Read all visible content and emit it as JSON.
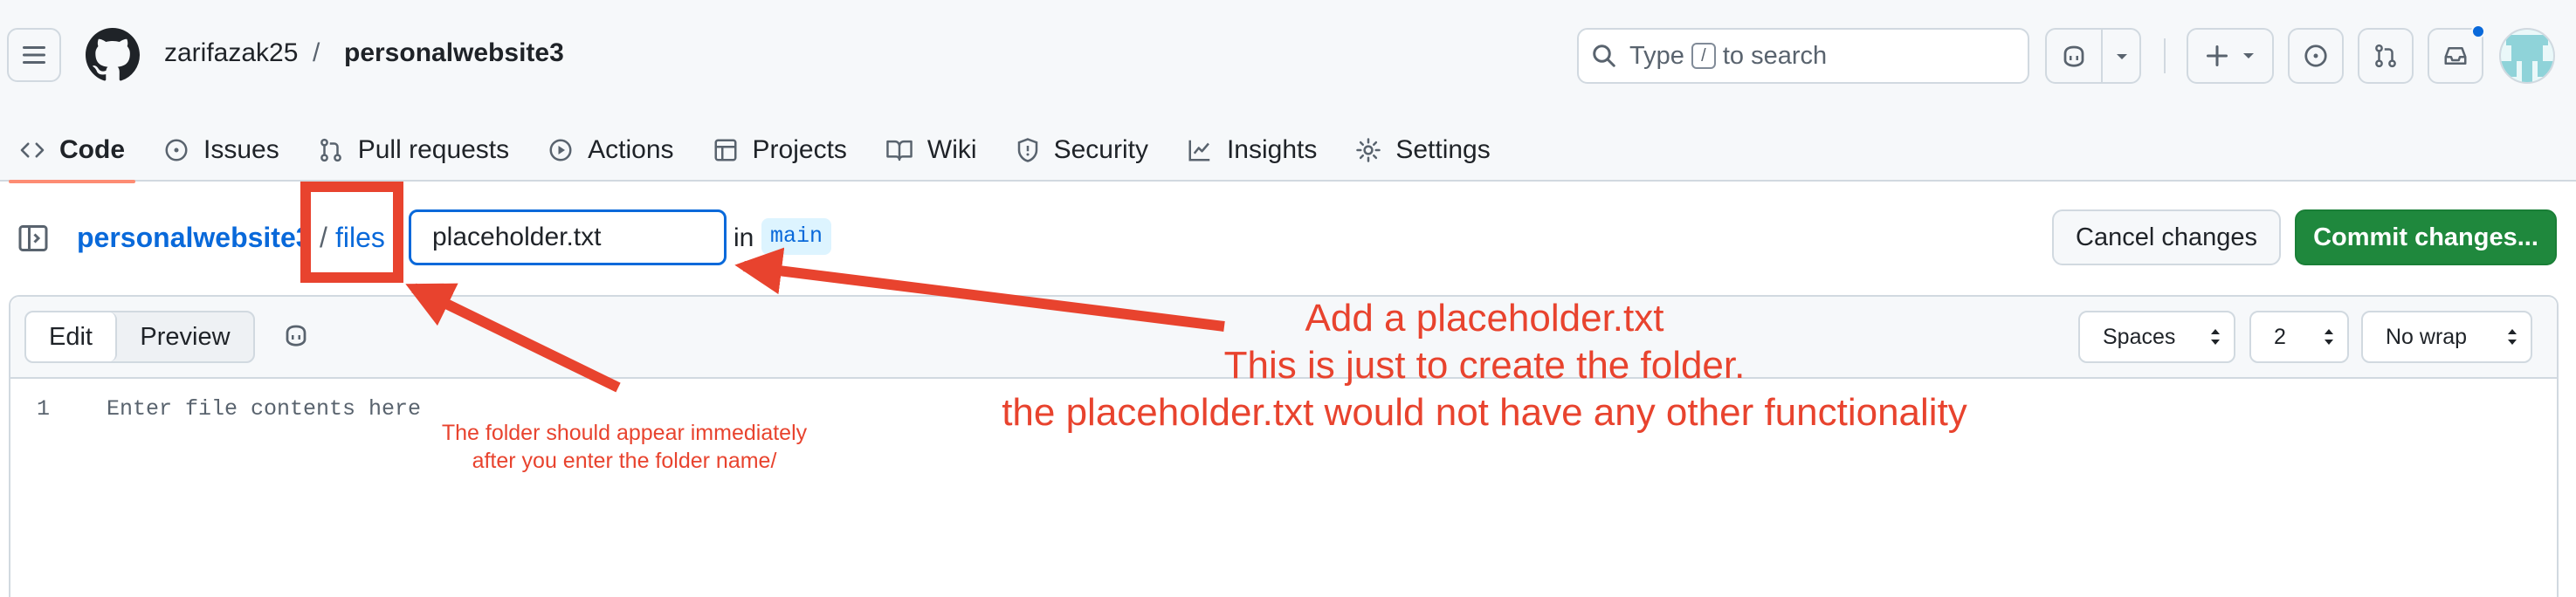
{
  "header": {
    "owner": "zarifazak25",
    "separator": "/",
    "repo": "personalwebsite3",
    "search": {
      "prefix": "Type",
      "key": "/",
      "suffix": "to search"
    }
  },
  "tabs": [
    {
      "label": "Code",
      "icon": "code-icon",
      "active": true
    },
    {
      "label": "Issues",
      "icon": "issue-icon"
    },
    {
      "label": "Pull requests",
      "icon": "pull-request-icon"
    },
    {
      "label": "Actions",
      "icon": "play-icon"
    },
    {
      "label": "Projects",
      "icon": "table-icon"
    },
    {
      "label": "Wiki",
      "icon": "book-icon"
    },
    {
      "label": "Security",
      "icon": "shield-icon"
    },
    {
      "label": "Insights",
      "icon": "graph-icon"
    },
    {
      "label": "Settings",
      "icon": "gear-icon"
    }
  ],
  "path": {
    "repo": "personalwebsite3",
    "sep1": "/",
    "folder": "files",
    "sep2": "/",
    "filename": "placeholder.txt",
    "in": "in",
    "branch": "main"
  },
  "actions": {
    "cancel": "Cancel changes",
    "commit": "Commit changes..."
  },
  "editor": {
    "tab_edit": "Edit",
    "tab_preview": "Preview",
    "indent_mode": "Spaces",
    "indent_size": "2",
    "wrap_mode": "No wrap",
    "line_number": "1",
    "placeholder": "Enter file contents here"
  },
  "annotations": {
    "main_line1": "Add a placeholder.txt",
    "main_line2": "This is just to create the folder.",
    "main_line3": "the placeholder.txt would not have any other functionality",
    "folder_line1": "The folder should appear immediately",
    "folder_line2": "after you enter the folder name/"
  },
  "colors": {
    "annotation": "#e8432e",
    "link": "#0969da",
    "commit_green": "#1f883d",
    "active_tab_underline": "#fd8c73"
  }
}
